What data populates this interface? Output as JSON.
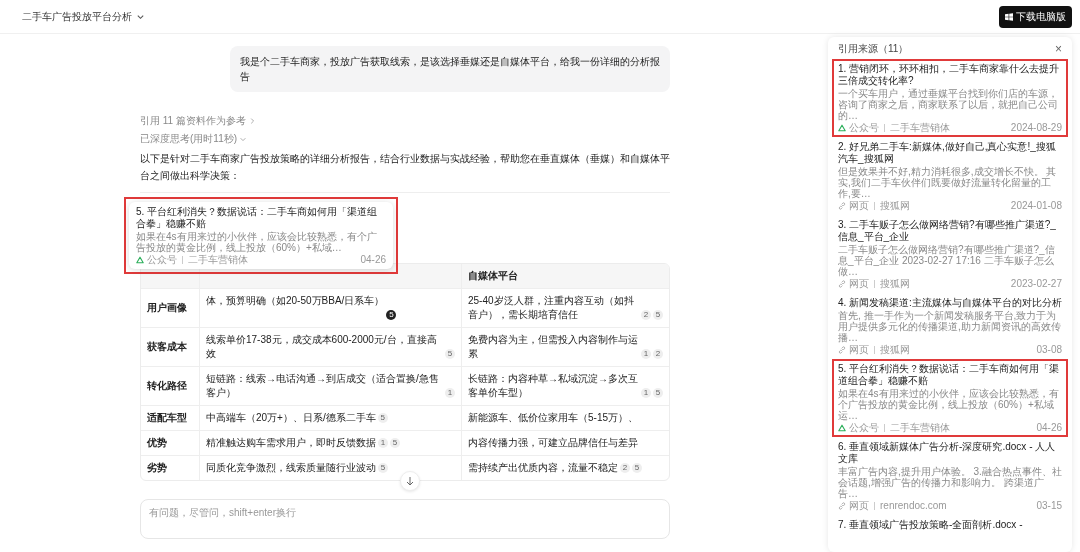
{
  "header": {
    "title": "二手车广告投放平台分析",
    "download_button": "下载电脑版"
  },
  "chat": {
    "user_message": "我是个二手车商家，投放广告获取线索，是该选择垂媒还是自媒体平台，给我一份详细的分析报告",
    "references_link": "引用 11 篇资料作为参考",
    "thinking_toggle": "已深度思考(用时11秒)",
    "intro": "以下是针对二手车商家广告投放策略的详细分析报告，结合行业数据与实战经验，帮助您在垂直媒体（垂媒）和自媒体平台之间做出科学决策：",
    "table": {
      "columns": [
        "",
        "",
        "自媒体平台"
      ],
      "rows": [
        {
          "label": "用户画像",
          "cells": [
            {
              "text": "体，预算明确（如20-50万BBA/日系车）",
              "cites": [
                {
                  "label": "5",
                  "selected": true
                }
              ]
            },
            {
              "text": "25-40岁泛人群，注重内容互动（如抖音户），需长期培育信任",
              "cites": [
                {
                  "label": "2",
                  "selected": false
                },
                {
                  "label": "5",
                  "selected": false
                }
              ]
            }
          ]
        },
        {
          "label": "获客成本",
          "cells": [
            {
              "text": "线索单价17-38元，成交成本600-2000元/台，直接高效",
              "cites": [
                {
                  "label": "5",
                  "selected": false
                }
              ]
            },
            {
              "text": "免费内容为主，但需投入内容制作与运累",
              "cites": [
                {
                  "label": "1",
                  "selected": false
                },
                {
                  "label": "2",
                  "selected": false
                }
              ]
            }
          ]
        },
        {
          "label": "转化路径",
          "cells": [
            {
              "text": "短链路：线索→电话沟通→到店成交（适合置换/急售客户）",
              "cites": [
                {
                  "label": "1",
                  "selected": false
                }
              ]
            },
            {
              "text": "长链路：内容种草→私域沉淀→多次互客单价车型）",
              "cites": [
                {
                  "label": "1",
                  "selected": false
                },
                {
                  "label": "5",
                  "selected": false
                }
              ]
            }
          ]
        },
        {
          "label": "适配车型",
          "cells": [
            {
              "text": "中高端车（20万+）、日系/德系二手车",
              "cites": [
                {
                  "label": "5",
                  "selected": false
                }
              ]
            },
            {
              "text": "新能源车、低价位家用车（5-15万）、"
            }
          ]
        },
        {
          "label": "优势",
          "cells": [
            {
              "text": "精准触达购车需求用户，即时反馈数据",
              "cites": [
                {
                  "label": "1",
                  "selected": false
                },
                {
                  "label": "5",
                  "selected": false
                }
              ]
            },
            {
              "text": "内容传播力强，可建立品牌信任与差异"
            }
          ]
        },
        {
          "label": "劣势",
          "cells": [
            {
              "text": "同质化竞争激烈，线索质量随行业波动",
              "cites": [
                {
                  "label": "5",
                  "selected": false
                }
              ]
            },
            {
              "text": "需持续产出优质内容，流量不稳定",
              "cites": [
                {
                  "label": "2",
                  "selected": false
                },
                {
                  "label": "5",
                  "selected": false
                }
              ]
            }
          ]
        }
      ]
    },
    "popover": {
      "title": "5. 平台红利消失？数据说话：二手车商如何用「渠道组合拳」稳赚不赔",
      "snippet": "如果在4s有用来过的小伙伴，应该会比较熟悉，有个广告投放的黄金比例，线上投放（60%）+私域…",
      "source_type": {
        "kind": "wechat",
        "label": "公众号"
      },
      "source": "二手车营销体",
      "date": "04-26",
      "highlighted": true
    },
    "input": {
      "placeholder": "有问题，尽管问，shift+enter换行"
    }
  },
  "sources_panel": {
    "title": "引用来源（11）",
    "close": "×",
    "items": [
      {
        "title": "1. 营销闭环，环环相扣，二手车商家靠什么去提升三倍成交转化率?",
        "snippet": "一个买车用户，通过垂媒平台找到你们店的车源，咨询了商家之后，商家联系了以后，就把自己公司的…",
        "source_type": {
          "kind": "wechat",
          "label": "公众号"
        },
        "source": "二手车营销体",
        "date": "2024-08-29",
        "highlighted": true
      },
      {
        "title": "2. 好兄弟二手车:新媒体,做好自己,真心实意!_搜狐汽车_搜狐网",
        "snippet": "但是效果并不好,精力消耗很多,成交增长不快。 其实,我们二手车伙伴们既要做好流量转化留量的工作,要…",
        "source_type": {
          "kind": "web",
          "label": "网页"
        },
        "source": "搜狐网",
        "date": "2024-01-08",
        "highlighted": false
      },
      {
        "title": "3. 二手车贩子怎么做网络营销?有哪些推广渠道?_信息_平台_企业",
        "snippet": "二手车贩子怎么做网络营销?有哪些推广渠道?_信息_平台_企业 2023-02-27 17:16 二手车贩子怎么做…",
        "source_type": {
          "kind": "web",
          "label": "网页"
        },
        "source": "搜狐网",
        "date": "2023-02-27",
        "highlighted": false
      },
      {
        "title": "4. 新闻发稿渠道:主流媒体与自媒体平台的对比分析",
        "snippet": "首先, 推一手作为一个新闻发稿服务平台,致力于为用户提供多元化的传播渠道,助力新闻资讯的高效传播…",
        "source_type": {
          "kind": "web",
          "label": "网页"
        },
        "source": "搜狐网",
        "date": "03-08",
        "highlighted": false
      },
      {
        "title": "5. 平台红利消失？数据说话：二手车商如何用「渠道组合拳」稳赚不赔",
        "snippet": "如果在4s有用来过的小伙伴，应该会比较熟悉，有个广告投放的黄金比例，线上投放（60%）+私域运…",
        "source_type": {
          "kind": "wechat",
          "label": "公众号"
        },
        "source": "二手车营销体",
        "date": "04-26",
        "highlighted": true
      },
      {
        "title": "6. 垂直领域新媒体广告分析-深度研究.docx - 人人文库",
        "snippet": "丰富广告内容,提升用户体验。 3.融合热点事件、社会话题,增强广告的传播力和影响力。 跨渠道广告…",
        "source_type": {
          "kind": "web",
          "label": "网页"
        },
        "source": "renrendoc.com",
        "date": "03-15",
        "highlighted": false
      },
      {
        "title": "7. 垂直领域广告投放策略-全面剖析.docx -",
        "highlighted": false
      }
    ]
  }
}
